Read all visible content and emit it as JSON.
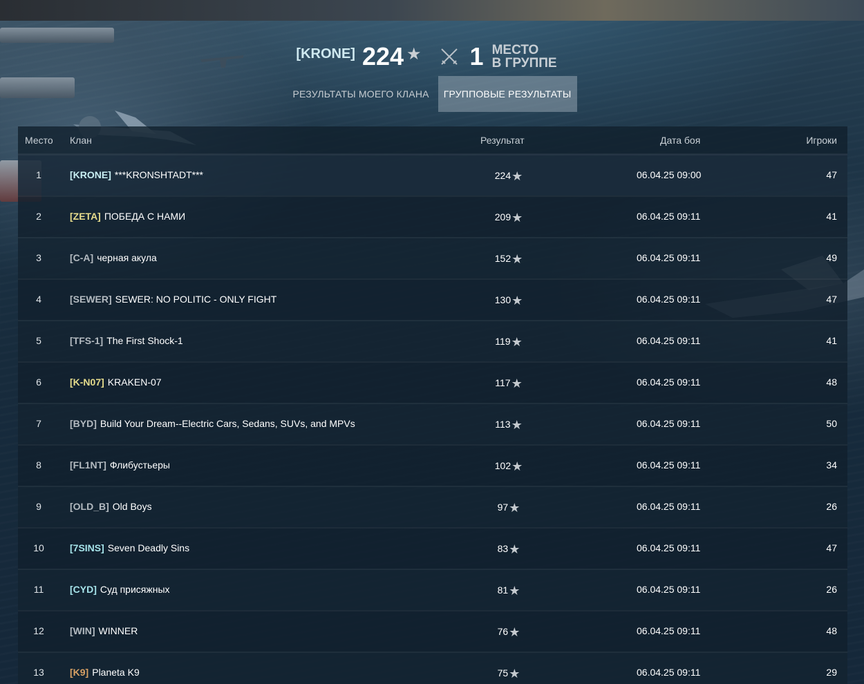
{
  "colors": {
    "accent_tab_active": "#aab9c3",
    "tag_cyan": "#c7eef2",
    "tag_yellow": "#e6dc8c",
    "tag_gray": "#b3bac0",
    "tag_orange": "#d7a064",
    "tag_teal": "#a6e4ea"
  },
  "header": {
    "clan_tag": "[KRONE]",
    "score": "224",
    "star_icon": "★",
    "place": "1",
    "place_label_line1": "МЕСТО",
    "place_label_line2": "В ГРУППЕ"
  },
  "tabs": [
    {
      "label": "РЕЗУЛЬТАТЫ МОЕГО КЛАНА",
      "active": false
    },
    {
      "label": "ГРУППОВЫЕ РЕЗУЛЬТАТЫ",
      "active": true
    }
  ],
  "table": {
    "columns": {
      "place": "Место",
      "clan": "Клан",
      "result": "Результат",
      "date": "Дата боя",
      "players": "Игроки"
    },
    "rows": [
      {
        "place": "1",
        "tag": "[KRONE]",
        "tag_color": "#c7eef2",
        "name": "***KRONSHTADT***",
        "result": "224",
        "date": "06.04.25 09:00",
        "players": "47"
      },
      {
        "place": "2",
        "tag": "[ZETA]",
        "tag_color": "#e6dc8c",
        "name": "ПОБЕДА С НАМИ",
        "result": "209",
        "date": "06.04.25 09:11",
        "players": "41"
      },
      {
        "place": "3",
        "tag": "[C-A]",
        "tag_color": "#b3bac0",
        "name": "черная акула",
        "result": "152",
        "date": "06.04.25 09:11",
        "players": "49"
      },
      {
        "place": "4",
        "tag": "[SEWER]",
        "tag_color": "#b3bac0",
        "name": "SEWER: NO POLITIC - ONLY FIGHT",
        "result": "130",
        "date": "06.04.25 09:11",
        "players": "47"
      },
      {
        "place": "5",
        "tag": "[TFS-1]",
        "tag_color": "#b3bac0",
        "name": "The First Shock-1",
        "result": "119",
        "date": "06.04.25 09:11",
        "players": "41"
      },
      {
        "place": "6",
        "tag": "[K-N07]",
        "tag_color": "#e6dc8c",
        "name": "KRAKEN-07",
        "result": "117",
        "date": "06.04.25 09:11",
        "players": "48"
      },
      {
        "place": "7",
        "tag": "[BYD]",
        "tag_color": "#b3bac0",
        "name": "Build Your Dream--Electric Cars, Sedans, SUVs, and MPVs",
        "result": "113",
        "date": "06.04.25 09:11",
        "players": "50"
      },
      {
        "place": "8",
        "tag": "[FL1NT]",
        "tag_color": "#b3bac0",
        "name": "Флибустьеры",
        "result": "102",
        "date": "06.04.25 09:11",
        "players": "34"
      },
      {
        "place": "9",
        "tag": "[OLD_B]",
        "tag_color": "#b3bac0",
        "name": "Old Boys",
        "result": "97",
        "date": "06.04.25 09:11",
        "players": "26"
      },
      {
        "place": "10",
        "tag": "[7SINS]",
        "tag_color": "#a6e4ea",
        "name": "Seven Deadly Sins",
        "result": "83",
        "date": "06.04.25 09:11",
        "players": "47"
      },
      {
        "place": "11",
        "tag": "[CYD]",
        "tag_color": "#a6e4ea",
        "name": "Суд присяжных",
        "result": "81",
        "date": "06.04.25 09:11",
        "players": "26"
      },
      {
        "place": "12",
        "tag": "[WIN]",
        "tag_color": "#b3bac0",
        "name": "WINNER",
        "result": "76",
        "date": "06.04.25 09:11",
        "players": "48"
      },
      {
        "place": "13",
        "tag": "[K9]",
        "tag_color": "#d7a064",
        "name": "Planeta K9",
        "result": "75",
        "date": "06.04.25 09:11",
        "players": "29"
      }
    ]
  }
}
